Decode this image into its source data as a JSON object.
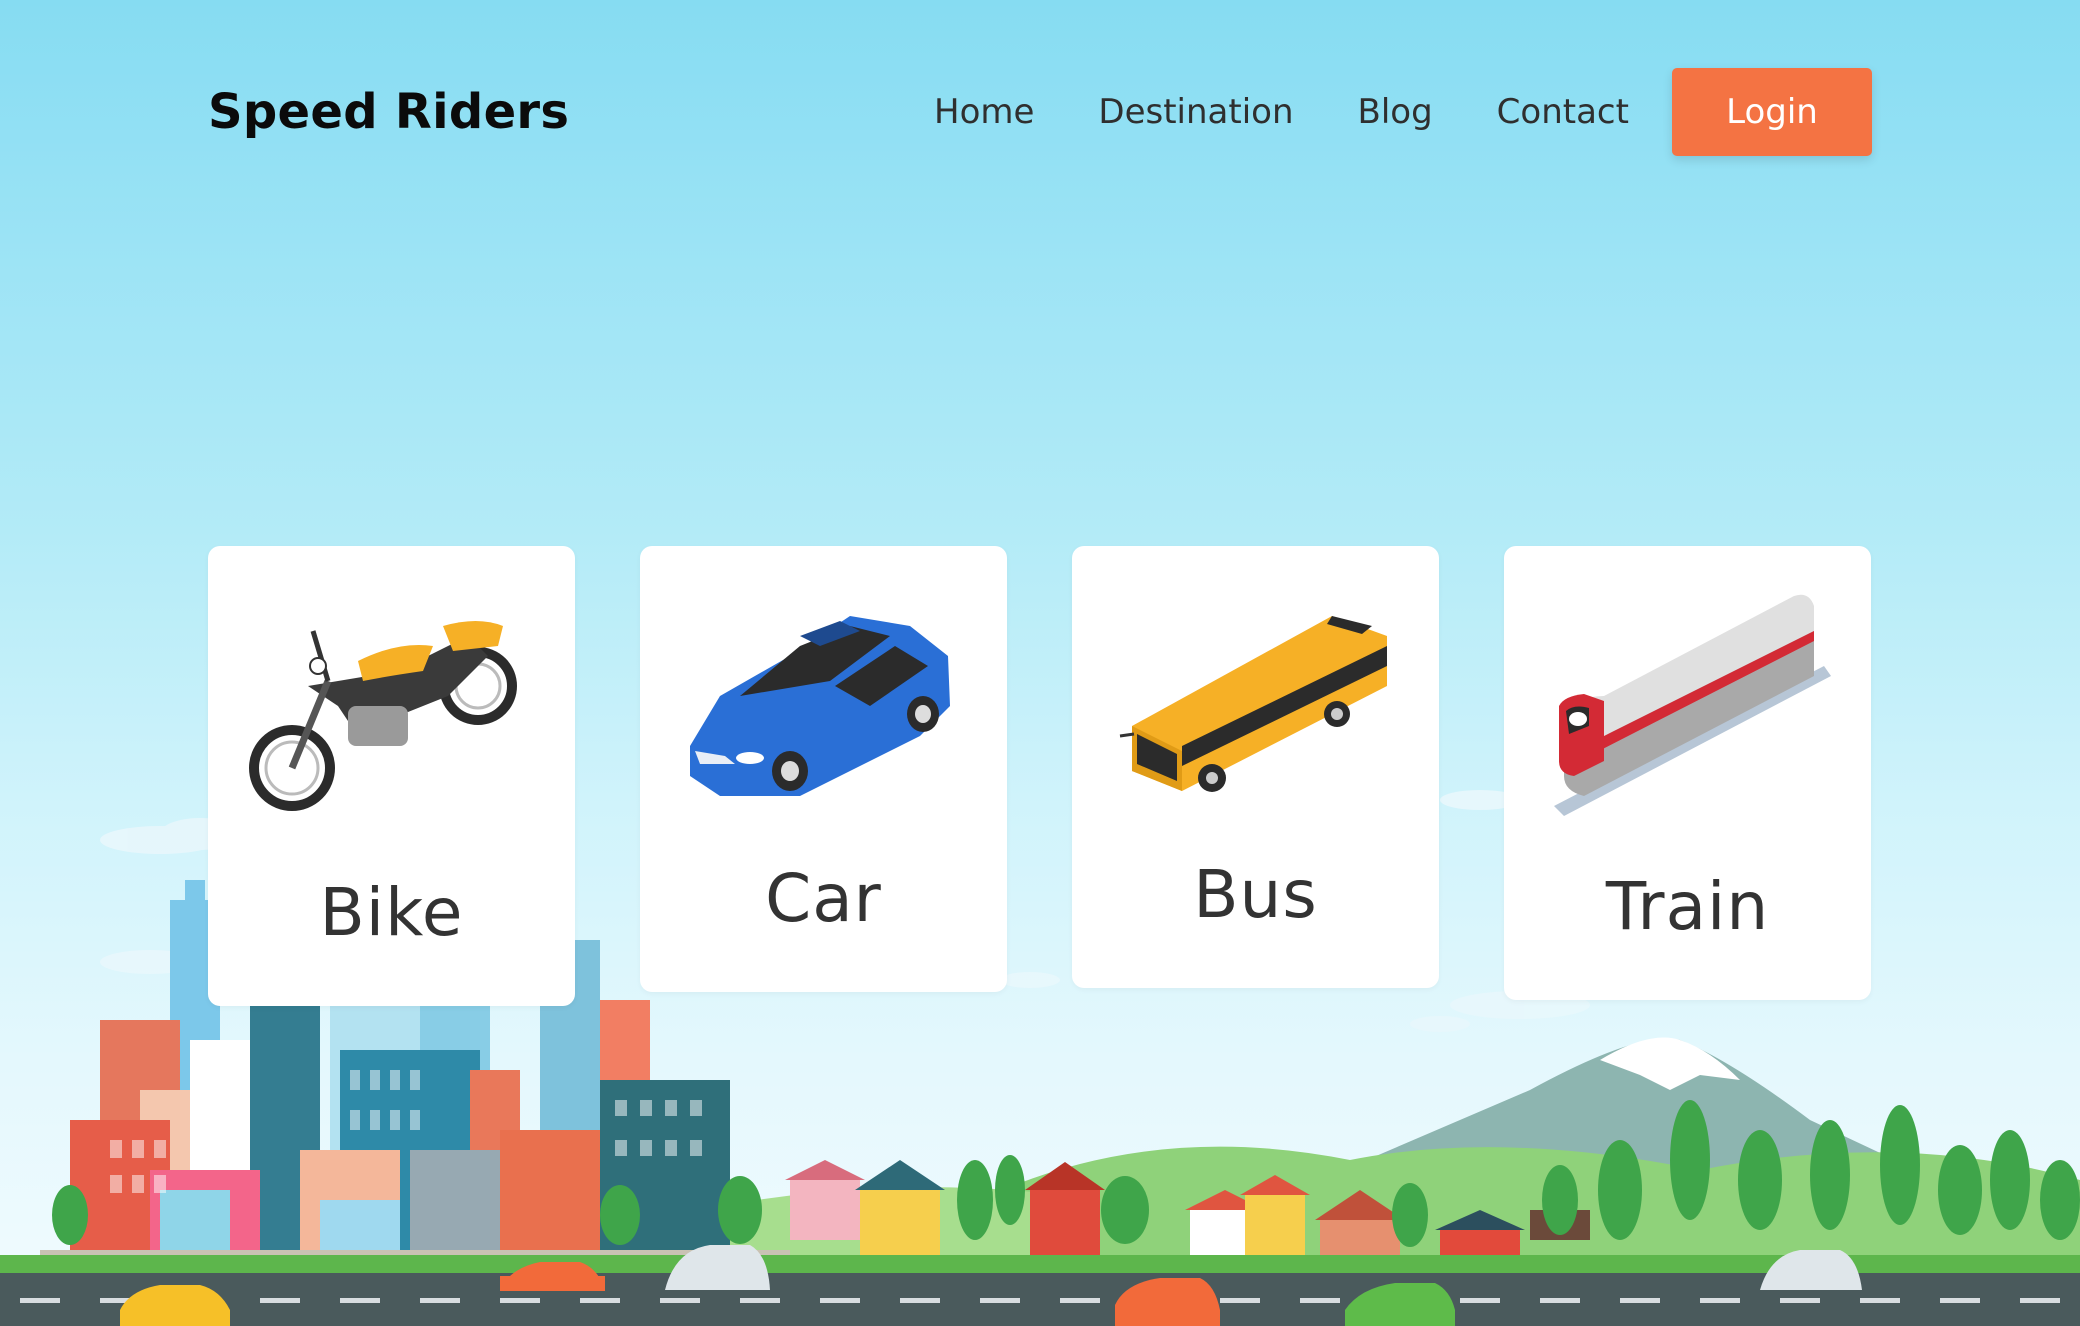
{
  "header": {
    "brand": "Speed Riders",
    "nav": [
      "Home",
      "Destination",
      "Blog",
      "Contact"
    ],
    "login_label": "Login"
  },
  "cards": [
    {
      "label": "Bike",
      "icon": "motorcycle-icon",
      "color": "#f6b026"
    },
    {
      "label": "Car",
      "icon": "car-icon",
      "color": "#2a6fd6"
    },
    {
      "label": "Bus",
      "icon": "bus-icon",
      "color": "#f6b026"
    },
    {
      "label": "Train",
      "icon": "train-icon",
      "color": "#d32a35"
    }
  ],
  "colors": {
    "accent": "#f47343",
    "sky_top": "#86dcf2",
    "text_dark": "#0b0b0b",
    "card_bg": "#ffffff",
    "road": "#4a5a5c"
  }
}
